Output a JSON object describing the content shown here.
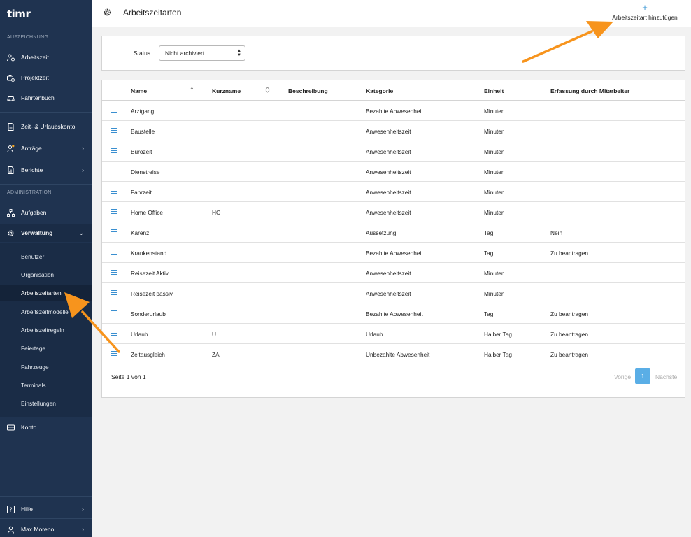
{
  "app": {
    "logo_text": "timr"
  },
  "sidebar": {
    "section_record": "AUFZEICHNUNG",
    "section_admin": "ADMINISTRATION",
    "items": [
      {
        "label": "Arbeitszeit",
        "icon": "user-clock-icon"
      },
      {
        "label": "Projektzeit",
        "icon": "briefcase-clock-icon"
      },
      {
        "label": "Fahrtenbuch",
        "icon": "car-icon"
      },
      {
        "label": "Zeit- & Urlaubskonto",
        "icon": "document-icon"
      },
      {
        "label": "Anträge",
        "icon": "user-request-icon"
      },
      {
        "label": "Berichte",
        "icon": "report-icon"
      },
      {
        "label": "Aufgaben",
        "icon": "hierarchy-icon"
      },
      {
        "label": "Verwaltung",
        "icon": "gear-icon"
      },
      {
        "label": "Konto",
        "icon": "credit-card-icon"
      },
      {
        "label": "Hilfe",
        "icon": "help-icon"
      },
      {
        "label": "Max Moreno",
        "icon": "user-icon"
      }
    ],
    "subitems": [
      "Benutzer",
      "Organisation",
      "Arbeitszeitarten",
      "Arbeitszeitmodelle",
      "Arbeitszeitregeln",
      "Feiertage",
      "Fahrzeuge",
      "Terminals",
      "Einstellungen"
    ]
  },
  "header": {
    "title": "Arbeitszeitarten",
    "add_label": "Arbeitszeitart hinzufügen"
  },
  "filter": {
    "status_label": "Status",
    "status_value": "Nicht archiviert"
  },
  "table": {
    "columns": [
      "Name",
      "Kurzname",
      "Beschreibung",
      "Kategorie",
      "Einheit",
      "Erfassung durch Mitarbeiter"
    ],
    "rows": [
      [
        "Arztgang",
        "",
        "",
        "Bezahlte Abwesenheit",
        "Minuten",
        ""
      ],
      [
        "Baustelle",
        "",
        "",
        "Anwesenheitszeit",
        "Minuten",
        ""
      ],
      [
        "Bürozeit",
        "",
        "",
        "Anwesenheitszeit",
        "Minuten",
        ""
      ],
      [
        "Dienstreise",
        "",
        "",
        "Anwesenheitszeit",
        "Minuten",
        ""
      ],
      [
        "Fahrzeit",
        "",
        "",
        "Anwesenheitszeit",
        "Minuten",
        ""
      ],
      [
        "Home Office",
        "HO",
        "",
        "Anwesenheitszeit",
        "Minuten",
        ""
      ],
      [
        "Karenz",
        "",
        "",
        "Aussetzung",
        "Tag",
        "Nein"
      ],
      [
        "Krankenstand",
        "",
        "",
        "Bezahlte Abwesenheit",
        "Tag",
        "Zu beantragen"
      ],
      [
        "Reisezeit Aktiv",
        "",
        "",
        "Anwesenheitszeit",
        "Minuten",
        ""
      ],
      [
        "Reisezeit passiv",
        "",
        "",
        "Anwesenheitszeit",
        "Minuten",
        ""
      ],
      [
        "Sonderurlaub",
        "",
        "",
        "Bezahlte Abwesenheit",
        "Tag",
        "Zu beantragen"
      ],
      [
        "Urlaub",
        "U",
        "",
        "Urlaub",
        "Halber Tag",
        "Zu beantragen"
      ],
      [
        "Zeitausgleich",
        "ZA",
        "",
        "Unbezahlte Abwesenheit",
        "Halber Tag",
        "Zu beantragen"
      ]
    ],
    "footer": {
      "page_info": "Seite 1 von 1",
      "prev": "Vorige",
      "page": "1",
      "next": "Nächste"
    }
  },
  "colors": {
    "sidebar_bg": "#1f3350",
    "accent": "#3a97d4",
    "annotation_arrow": "#f7941d"
  }
}
